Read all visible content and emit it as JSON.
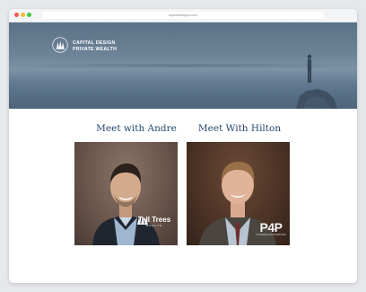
{
  "browser": {
    "url": "capitaldesignpw.com"
  },
  "header": {
    "logo_line1": "CAPITAL DESIGN",
    "logo_line2": "PRIVATE WEALTH"
  },
  "advisors": [
    {
      "heading": "Meet with Andre",
      "badge_name": "Tall Trees",
      "badge_sub": "WEALTH"
    },
    {
      "heading": "Meet With Hilton",
      "badge_name": "P4P",
      "badge_sub": "PLANNING FOR PURPOSE"
    }
  ],
  "colors": {
    "heading": "#23476b",
    "hero": "#5b7287"
  },
  "icons": [
    "tree-logo-icon",
    "standing-figure-icon",
    "rock-icon",
    "tall-trees-logo-icon",
    "p4p-logo-icon"
  ]
}
